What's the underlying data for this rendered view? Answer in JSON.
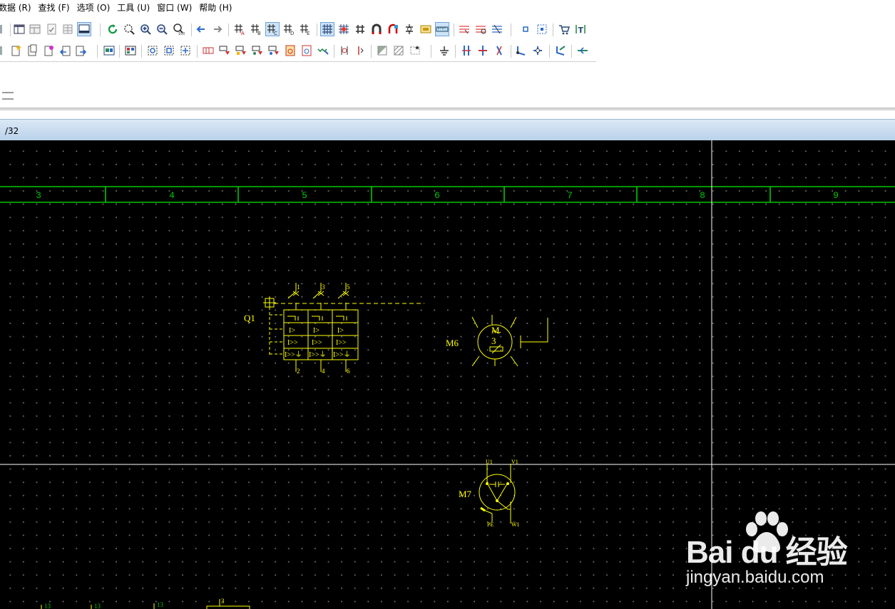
{
  "menu": [
    "数据 (R)",
    "查找 (F)",
    "选项 (O)",
    "工具 (U)",
    "窗口 (W)",
    "帮助 (H)"
  ],
  "tab": {
    "label": "/32"
  },
  "ruler": {
    "columns": [
      "3",
      "4",
      "5",
      "6",
      "7",
      "8",
      "9"
    ]
  },
  "components": {
    "q1": {
      "tag": "Q1",
      "top_pins": [
        "1",
        "3",
        "5"
      ],
      "bottom_pins": [
        "2",
        "4",
        "6"
      ],
      "rows": [
        [
          "I>",
          "I>",
          "I>"
        ],
        [
          "I>>",
          "I>>",
          "I>>"
        ],
        [
          "I>>⏚",
          "I>>⏚",
          "I>>⏚"
        ]
      ]
    },
    "m6": {
      "tag": "M6",
      "letter": "M",
      "number": "3"
    },
    "m7": {
      "tag": "M7",
      "pins": {
        "u1": "U1",
        "v1": "V1",
        "w1": "W1",
        "pe": "PE"
      }
    },
    "bottom_labels": [
      "13",
      "13",
      "13",
      "3"
    ]
  },
  "watermark": {
    "brand": "Bai du 经验",
    "url": "jingyan.baidu.com"
  },
  "colors": {
    "canvas": "#000000",
    "grid": "#00c800",
    "symbol": "#ffff00",
    "crosshair": "#ffffff"
  }
}
